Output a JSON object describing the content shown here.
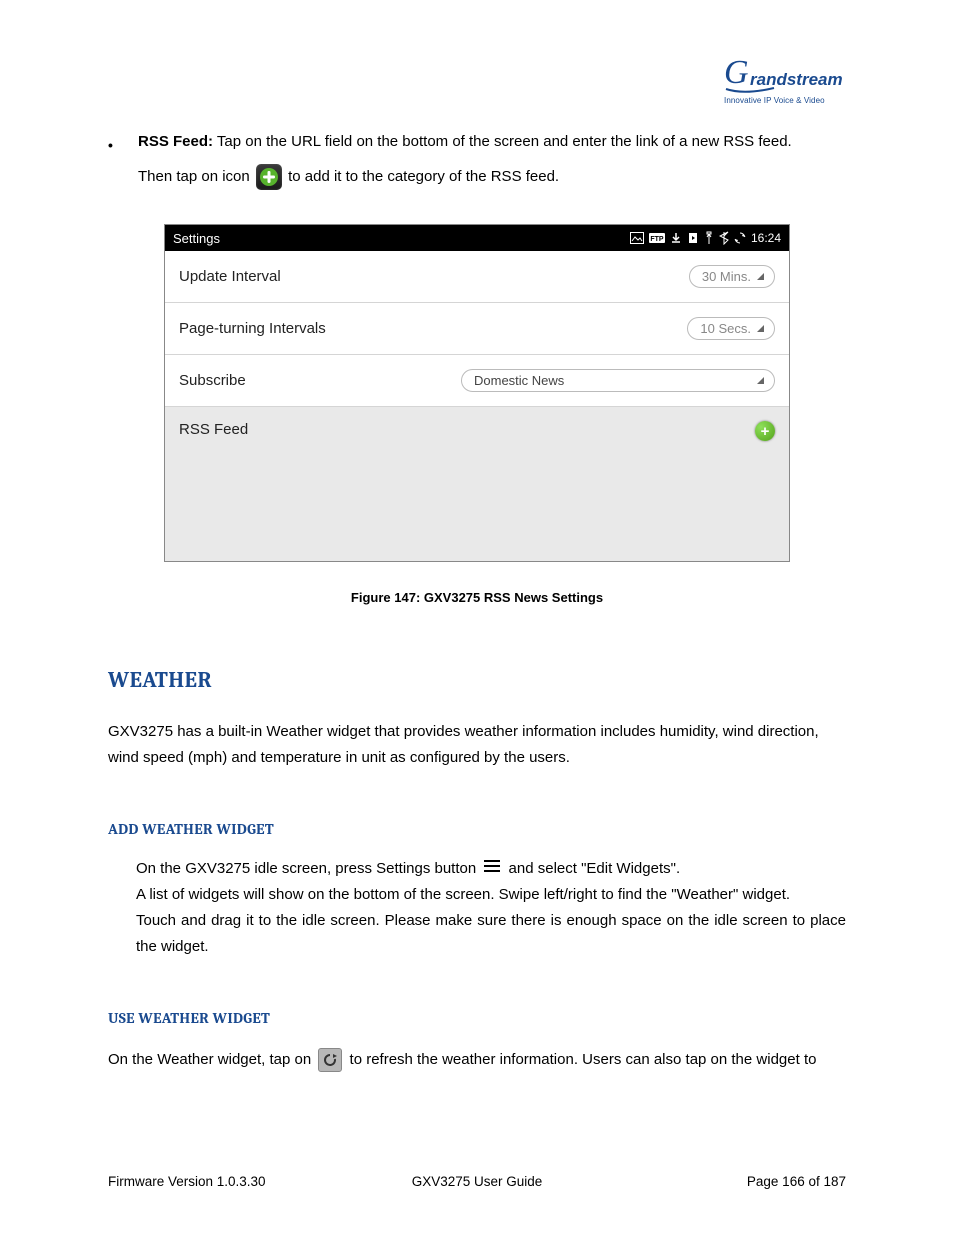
{
  "logo": {
    "brand_script": "G",
    "brand_text": "randstream",
    "tagline": "Innovative IP Voice & Video"
  },
  "bullet": {
    "title": "RSS Feed:",
    "line1_before": " Tap on the URL field on the bottom of the screen and enter the link of a new RSS feed.",
    "line2_before": "Then tap on icon ",
    "line2_after": " to add it to the category of the RSS feed."
  },
  "screenshot": {
    "title": "Settings",
    "clock": "16:24",
    "rows": {
      "update_label": "Update Interval",
      "update_value": "30 Mins.",
      "page_label": "Page-turning Intervals",
      "page_value": "10 Secs.",
      "subscribe_label": "Subscribe",
      "subscribe_value": "Domestic News",
      "rss_label": "RSS Feed"
    }
  },
  "caption": "Figure 147: GXV3275 RSS News Settings",
  "sections": {
    "weather_title": "WEATHER",
    "weather_body": "GXV3275 has a built-in Weather widget that provides weather information includes humidity, wind direction, wind speed (mph) and temperature in unit as configured by the users.",
    "add_title": "ADD WEATHER WIDGET",
    "add_l1_before": "On the GXV3275 idle screen, press Settings button ",
    "add_l1_after": " and select \"Edit Widgets\".",
    "add_l2": "A list of widgets will show on the bottom of the screen. Swipe left/right to find the \"Weather\" widget.",
    "add_l3": "Touch and drag it to the idle screen. Please make sure there is enough space on the idle screen to place the widget.",
    "use_title": "USE WEATHER WIDGET",
    "use_before": "On the Weather widget, tap on ",
    "use_after": " to refresh the weather information. Users can also tap on the widget to"
  },
  "footer": {
    "left": "Firmware Version 1.0.3.30",
    "center": "GXV3275 User Guide",
    "right": "Page 166 of 187"
  }
}
